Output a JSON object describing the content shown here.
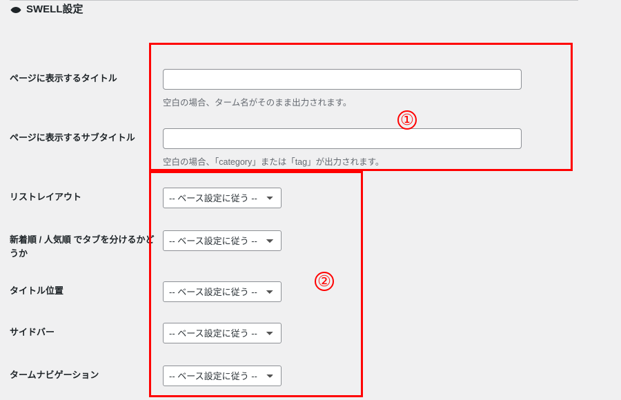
{
  "header": {
    "title": "SWELL設定",
    "icon": "swell-logo-icon"
  },
  "fields": {
    "title": {
      "label": "ページに表示するタイトル",
      "value": "",
      "hint": "空白の場合、ターム名がそのまま出力されます。"
    },
    "subtitle": {
      "label": "ページに表示するサブタイトル",
      "value": "",
      "hint": "空白の場合、「category」または「tag」が出力されます。"
    },
    "list_layout": {
      "label": "リストレイアウト",
      "selected": "-- ベース設定に従う --"
    },
    "tab_split": {
      "label": "新着順 / 人気順 でタブを分けるかどうか",
      "selected": "-- ベース設定に従う --"
    },
    "title_position": {
      "label": "タイトル位置",
      "selected": "-- ベース設定に従う --"
    },
    "sidebar": {
      "label": "サイドバー",
      "selected": "-- ベース設定に従う --"
    },
    "term_nav": {
      "label": "タームナビゲーション",
      "selected": "-- ベース設定に従う --"
    }
  },
  "annotations": {
    "one": "①",
    "two": "②"
  }
}
